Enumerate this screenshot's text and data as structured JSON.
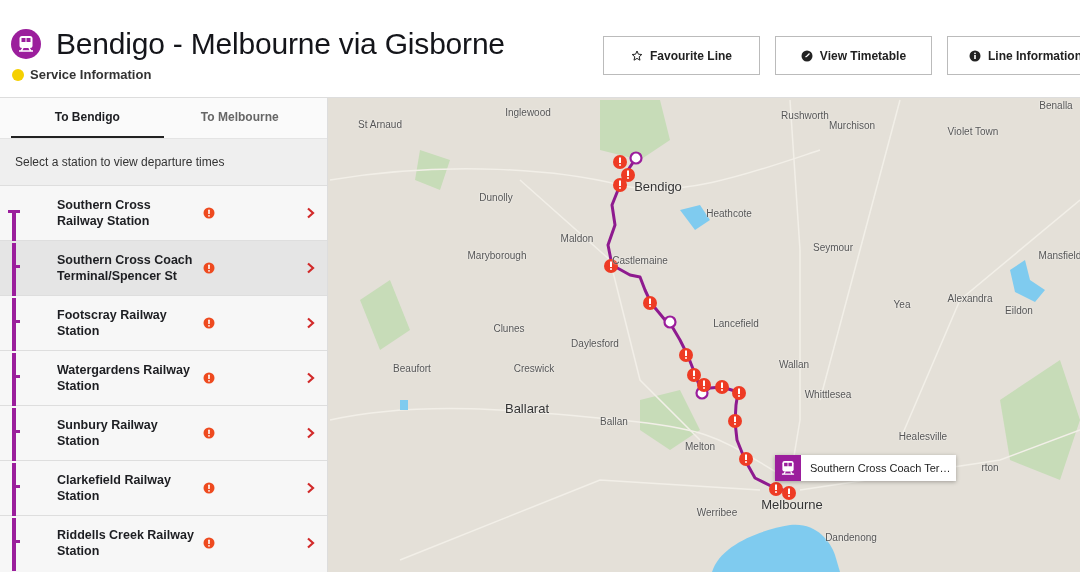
{
  "header": {
    "title": "Bendigo - Melbourne via Gisborne",
    "service_info": {
      "label": "Service Information",
      "color": "#f5d000"
    },
    "buttons": [
      {
        "kind": "star",
        "label": "Favourite Line"
      },
      {
        "kind": "clock",
        "label": "View Timetable"
      },
      {
        "kind": "info",
        "label": "Line Information"
      }
    ]
  },
  "tabs": [
    {
      "label": "To Bendigo",
      "selected": true
    },
    {
      "label": "To Melbourne",
      "selected": false
    }
  ],
  "hint": "Select a station to view departure times",
  "stations": [
    {
      "name": "Southern Cross Railway Station",
      "alert": true,
      "selected": false
    },
    {
      "name": "Southern Cross Coach Terminal/Spencer St",
      "alert": true,
      "selected": true
    },
    {
      "name": "Footscray Railway Station",
      "alert": true,
      "selected": false
    },
    {
      "name": "Watergardens Railway Station",
      "alert": true,
      "selected": false
    },
    {
      "name": "Sunbury Railway Station",
      "alert": true,
      "selected": false
    },
    {
      "name": "Clarkefield Railway Station",
      "alert": true,
      "selected": false
    },
    {
      "name": "Riddells Creek Railway Station",
      "alert": true,
      "selected": false
    }
  ],
  "map": {
    "places": [
      {
        "name": "St Arnaud",
        "kind": "town"
      },
      {
        "name": "Inglewood",
        "kind": "town"
      },
      {
        "name": "Rushworth",
        "kind": "town"
      },
      {
        "name": "Murchison",
        "kind": "town"
      },
      {
        "name": "Benalla",
        "kind": "town"
      },
      {
        "name": "Violet Town",
        "kind": "town"
      },
      {
        "name": "Bendigo",
        "kind": "city"
      },
      {
        "name": "Dunolly",
        "kind": "town"
      },
      {
        "name": "Heathcote",
        "kind": "town"
      },
      {
        "name": "Maldon",
        "kind": "town"
      },
      {
        "name": "Maryborough",
        "kind": "town"
      },
      {
        "name": "Castlemaine",
        "kind": "town"
      },
      {
        "name": "Seymour",
        "kind": "town"
      },
      {
        "name": "Mansfield",
        "kind": "town"
      },
      {
        "name": "Yea",
        "kind": "town"
      },
      {
        "name": "Alexandra",
        "kind": "town"
      },
      {
        "name": "Eildon",
        "kind": "town"
      },
      {
        "name": "Clunes",
        "kind": "town"
      },
      {
        "name": "Lancefield",
        "kind": "town"
      },
      {
        "name": "Daylesford",
        "kind": "town"
      },
      {
        "name": "Beaufort",
        "kind": "town"
      },
      {
        "name": "Creswick",
        "kind": "town"
      },
      {
        "name": "Wallan",
        "kind": "town"
      },
      {
        "name": "Whittlesea",
        "kind": "town"
      },
      {
        "name": "Ballarat",
        "kind": "city"
      },
      {
        "name": "Ballan",
        "kind": "town"
      },
      {
        "name": "Melton",
        "kind": "town"
      },
      {
        "name": "Healesville",
        "kind": "town"
      },
      {
        "name": "rton",
        "kind": "town"
      },
      {
        "name": "Werribee",
        "kind": "town"
      },
      {
        "name": "Melbourne",
        "kind": "city"
      },
      {
        "name": "Dandenong",
        "kind": "town"
      }
    ],
    "popup": {
      "label": "Southern Cross Coach Ter…"
    }
  }
}
